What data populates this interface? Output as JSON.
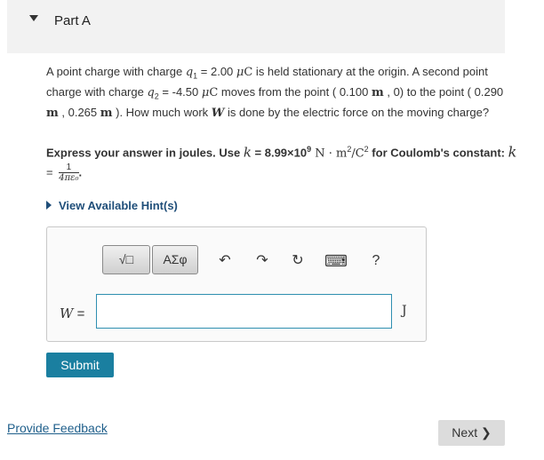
{
  "part": {
    "title": "Part A"
  },
  "problem": {
    "s1": "A point charge with charge ",
    "q1": "q",
    "q1_sub": "1",
    "s2": " = 2.00 ",
    "mu1": "μ",
    "C1": "C",
    "s3": " is held stationary at the origin. A second point charge with charge ",
    "q2": "q",
    "q2_sub": "2",
    "s4": " = -4.50 ",
    "mu2": "μ",
    "C2": "C",
    "s5": " moves from the point ( 0.100 ",
    "m1": "m",
    "s6": " , 0) to the point ( 0.290 ",
    "m2": "m",
    "s7": " , 0.265 ",
    "m3": "m",
    "s8": " ). How much work ",
    "W": "W",
    "s9": " is done by the electric force on the moving charge?"
  },
  "instructions": {
    "s1": "Express your answer in joules. Use ",
    "k": "k",
    "s2": " = 8.99×10",
    "exp9": "9",
    "units": " N · m",
    "exp2": "2",
    "slash": "/C",
    "exp2b": "2",
    "s3": " for Coulomb's constant: ",
    "k2": "k",
    "eq": " = ",
    "num": "1",
    "den": "4πε₀",
    "period": "."
  },
  "hint": {
    "label": "View Available Hint(s)"
  },
  "toolbar": {
    "template_label": "√□",
    "greek_label": "ΑΣφ",
    "undo": "↶",
    "redo": "↷",
    "reset": "↻",
    "keyboard": "⌨",
    "help": "?"
  },
  "answer": {
    "variable": "W",
    "equals": " =",
    "value": "",
    "unit": "J"
  },
  "buttons": {
    "submit": "Submit",
    "next": "Next ❯"
  },
  "links": {
    "feedback": "Provide Feedback"
  }
}
